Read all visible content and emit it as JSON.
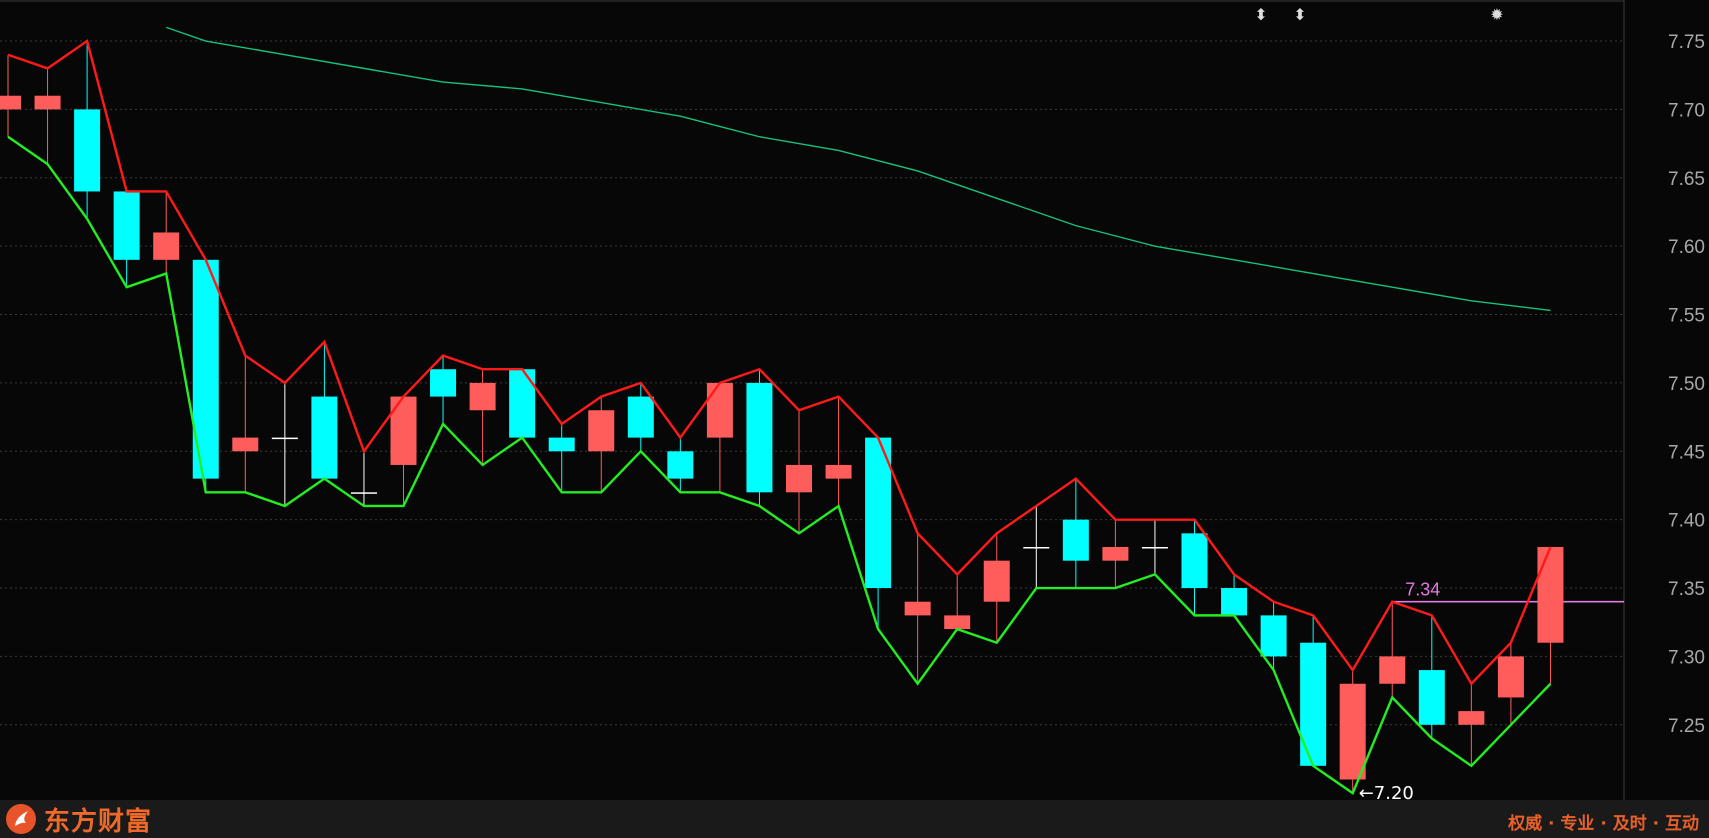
{
  "chart_data": {
    "type": "candlestick",
    "ylim": [
      7.195,
      7.78
    ],
    "y_ticks": [
      "7.75",
      "7.70",
      "7.65",
      "7.60",
      "7.55",
      "7.50",
      "7.45",
      "7.40",
      "7.35",
      "7.30",
      "7.25"
    ],
    "candles": [
      {
        "o": 7.7,
        "c": 7.71,
        "h": 7.74,
        "l": 7.68
      },
      {
        "o": 7.7,
        "c": 7.71,
        "h": 7.73,
        "l": 7.66
      },
      {
        "o": 7.7,
        "c": 7.64,
        "h": 7.75,
        "l": 7.62
      },
      {
        "o": 7.64,
        "c": 7.59,
        "h": 7.64,
        "l": 7.57
      },
      {
        "o": 7.59,
        "c": 7.61,
        "h": 7.64,
        "l": 7.58
      },
      {
        "o": 7.59,
        "c": 7.43,
        "h": 7.59,
        "l": 7.42
      },
      {
        "o": 7.45,
        "c": 7.46,
        "h": 7.52,
        "l": 7.42
      },
      {
        "o": 7.46,
        "c": 7.46,
        "h": 7.5,
        "l": 7.41
      },
      {
        "o": 7.49,
        "c": 7.43,
        "h": 7.53,
        "l": 7.43
      },
      {
        "o": 7.42,
        "c": 7.42,
        "h": 7.45,
        "l": 7.41
      },
      {
        "o": 7.44,
        "c": 7.49,
        "h": 7.49,
        "l": 7.41
      },
      {
        "o": 7.51,
        "c": 7.49,
        "h": 7.52,
        "l": 7.47
      },
      {
        "o": 7.48,
        "c": 7.5,
        "h": 7.51,
        "l": 7.44
      },
      {
        "o": 7.51,
        "c": 7.46,
        "h": 7.51,
        "l": 7.46
      },
      {
        "o": 7.46,
        "c": 7.45,
        "h": 7.47,
        "l": 7.42
      },
      {
        "o": 7.45,
        "c": 7.48,
        "h": 7.49,
        "l": 7.42
      },
      {
        "o": 7.49,
        "c": 7.46,
        "h": 7.5,
        "l": 7.45
      },
      {
        "o": 7.45,
        "c": 7.43,
        "h": 7.46,
        "l": 7.42
      },
      {
        "o": 7.46,
        "c": 7.5,
        "h": 7.5,
        "l": 7.42
      },
      {
        "o": 7.5,
        "c": 7.42,
        "h": 7.51,
        "l": 7.41
      },
      {
        "o": 7.42,
        "c": 7.44,
        "h": 7.48,
        "l": 7.39
      },
      {
        "o": 7.43,
        "c": 7.44,
        "h": 7.49,
        "l": 7.41
      },
      {
        "o": 7.46,
        "c": 7.35,
        "h": 7.46,
        "l": 7.32
      },
      {
        "o": 7.33,
        "c": 7.34,
        "h": 7.39,
        "l": 7.28
      },
      {
        "o": 7.32,
        "c": 7.33,
        "h": 7.36,
        "l": 7.32
      },
      {
        "o": 7.34,
        "c": 7.37,
        "h": 7.39,
        "l": 7.31
      },
      {
        "o": 7.38,
        "c": 7.38,
        "h": 7.41,
        "l": 7.35
      },
      {
        "o": 7.4,
        "c": 7.37,
        "h": 7.43,
        "l": 7.35
      },
      {
        "o": 7.37,
        "c": 7.38,
        "h": 7.4,
        "l": 7.35
      },
      {
        "o": 7.38,
        "c": 7.38,
        "h": 7.4,
        "l": 7.36
      },
      {
        "o": 7.39,
        "c": 7.35,
        "h": 7.4,
        "l": 7.33
      },
      {
        "o": 7.35,
        "c": 7.33,
        "h": 7.36,
        "l": 7.33
      },
      {
        "o": 7.33,
        "c": 7.3,
        "h": 7.34,
        "l": 7.29
      },
      {
        "o": 7.31,
        "c": 7.22,
        "h": 7.33,
        "l": 7.22
      },
      {
        "o": 7.21,
        "c": 7.28,
        "h": 7.29,
        "l": 7.2
      },
      {
        "o": 7.28,
        "c": 7.3,
        "h": 7.34,
        "l": 7.27
      },
      {
        "o": 7.29,
        "c": 7.25,
        "h": 7.33,
        "l": 7.24
      },
      {
        "o": 7.25,
        "c": 7.26,
        "h": 7.28,
        "l": 7.22
      },
      {
        "o": 7.27,
        "c": 7.3,
        "h": 7.31,
        "l": 7.25
      },
      {
        "o": 7.31,
        "c": 7.38,
        "h": 7.38,
        "l": 7.28
      }
    ],
    "ma_line": [
      [
        4,
        7.76
      ],
      [
        5,
        7.75
      ],
      [
        7,
        7.74
      ],
      [
        9,
        7.73
      ],
      [
        11,
        7.72
      ],
      [
        13,
        7.715
      ],
      [
        15,
        7.705
      ],
      [
        17,
        7.695
      ],
      [
        19,
        7.68
      ],
      [
        21,
        7.67
      ],
      [
        23,
        7.655
      ],
      [
        25,
        7.635
      ],
      [
        27,
        7.615
      ],
      [
        29,
        7.6
      ],
      [
        31,
        7.59
      ],
      [
        33,
        7.58
      ],
      [
        35,
        7.57
      ],
      [
        37,
        7.56
      ],
      [
        39,
        7.553
      ]
    ],
    "horizontal_line": {
      "value": 7.34,
      "label": "7.34",
      "from_index": 35
    },
    "low_marker": {
      "index": 34,
      "label": "←7.20"
    },
    "top_markers": [
      "⬍",
      "⬍",
      "✹"
    ],
    "colors": {
      "up": "#ff5c5c",
      "down": "#00ffff",
      "upper_band": "#ff1a1a",
      "lower_band": "#22ee22",
      "ma": "#16c27a",
      "hline": "#e27ae2",
      "axis_text": "#a8a8a8",
      "grid": "#3a3a3a"
    }
  },
  "footer": {
    "brand": "东方财富",
    "slogan": "权威 · 专业 · 及时 · 互动"
  }
}
